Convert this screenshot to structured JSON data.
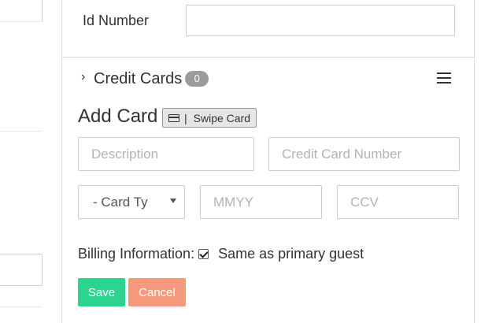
{
  "id_number": {
    "label": "Id Number",
    "value": ""
  },
  "credit_cards": {
    "title": "Credit Cards",
    "count": "0",
    "menu_icon": "hamburger-menu-icon",
    "chevron_icon": "chevron-right-icon"
  },
  "add_card": {
    "title": "Add Card",
    "swipe_separator": "|",
    "swipe_label": "Swipe Card",
    "swipe_icon": "credit-card-icon",
    "description_placeholder": "Description",
    "card_number_placeholder": "Credit Card Number",
    "card_type_selected": "- Card Ty",
    "expiry_placeholder": "MMYY",
    "ccv_placeholder": "CCV"
  },
  "billing": {
    "label": "Billing Information:",
    "checkbox_checked": true,
    "checkbox_label": "Same as primary guest"
  },
  "actions": {
    "save_label": "Save",
    "cancel_label": "Cancel"
  },
  "colors": {
    "save": "#2bd48f",
    "cancel": "#f59a7c",
    "badge": "#9b9b9b",
    "border": "#cccccc"
  }
}
